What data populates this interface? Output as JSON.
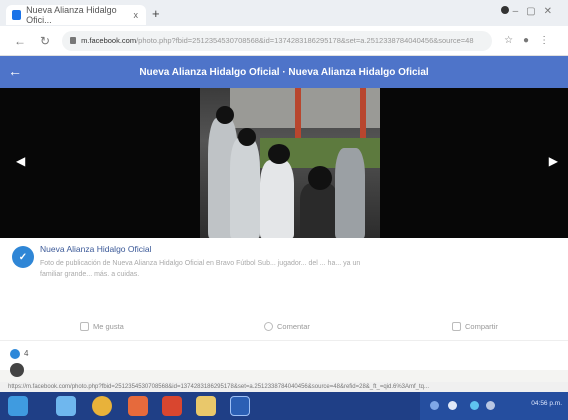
{
  "browser": {
    "tab_title": "Nueva Alianza Hidalgo Ofici...",
    "tab_close": "x",
    "new_tab": "+",
    "address_host": "m.facebook.com",
    "address_rest": "/photo.php?fbid=2512354530708568&id=1374283186295178&set=a.2512338784040456&source=48",
    "status_url": "https://m.facebook.com/photo.php?fbid=2512354530708568&id=1374283186295178&set=a.2512338784040456&source=48&refid=28&_ft_=qid.6%3Amf_tq...",
    "colors": {
      "tabbar": "#eceff3",
      "taskbar": "#1f3f86"
    }
  },
  "header": {
    "title": "Nueva Alianza Hidalgo Oficial · Nueva Alianza Hidalgo Oficial",
    "back_icon": "arrow-left-icon",
    "color": "#4e74c9"
  },
  "post": {
    "page_name": "Nueva Alianza Hidalgo Oficial",
    "caption": "Foto de publicación de Nueva Alianza Hidalgo Oficial en Bravo Fútbol Sub... jugador... del ... ha... ya un familiar grande... más. a cuidas.",
    "like_label": "Me gusta",
    "comment_label": "Comentar",
    "share_label": "Compartir"
  },
  "reactions": {
    "count": "4"
  },
  "taskbar": {
    "clock": "04:56 p.m."
  }
}
